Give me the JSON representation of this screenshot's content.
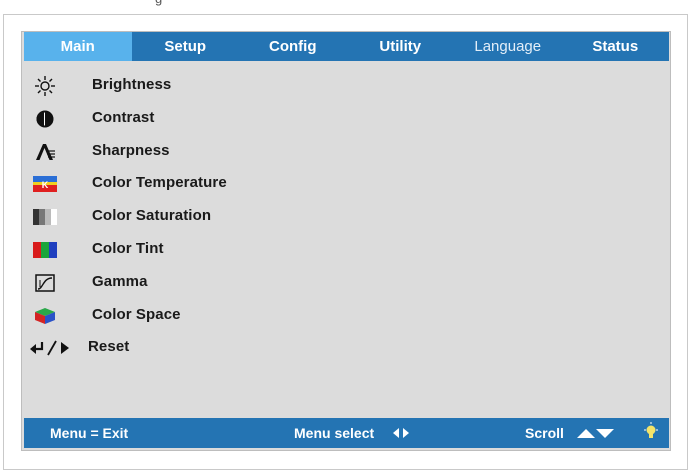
{
  "header_text": "g",
  "tabs": [
    {
      "label": "Main",
      "active": true
    },
    {
      "label": "Setup",
      "active": false
    },
    {
      "label": "Config",
      "active": false
    },
    {
      "label": "Utility",
      "active": false
    },
    {
      "label": "Language",
      "active": false
    },
    {
      "label": "Status",
      "active": false
    }
  ],
  "menu_items": [
    {
      "label": "Brightness",
      "icon": "brightness-icon"
    },
    {
      "label": "Contrast",
      "icon": "contrast-icon"
    },
    {
      "label": "Sharpness",
      "icon": "sharpness-icon"
    },
    {
      "label": "Color Temperature",
      "icon": "color-temperature-icon"
    },
    {
      "label": "Color Saturation",
      "icon": "color-saturation-icon"
    },
    {
      "label": "Color Tint",
      "icon": "color-tint-icon"
    },
    {
      "label": "Gamma",
      "icon": "gamma-icon"
    },
    {
      "label": "Color Space",
      "icon": "color-space-icon"
    },
    {
      "label": "Reset",
      "icon": "reset-icon"
    }
  ],
  "footer": {
    "menu_exit": "Menu = Exit",
    "menu_select": "Menu select",
    "scroll": "Scroll"
  },
  "colors": {
    "bar": "#2474b3",
    "active_tab": "#58b2ec",
    "panel": "#dcdcdc"
  }
}
